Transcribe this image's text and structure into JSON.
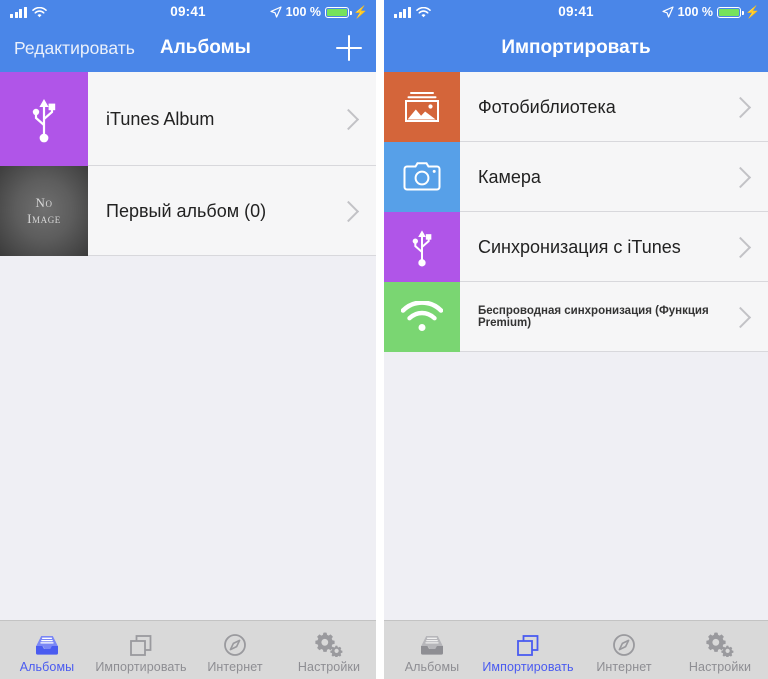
{
  "status_bar": {
    "time": "09:41",
    "battery_percent": "100 %",
    "signal_icon": "cellular-bars-icon",
    "wifi_icon": "wifi-icon",
    "location_icon": "location-arrow-icon",
    "battery_icon": "battery-icon",
    "charging_icon": "lightning-bolt-icon"
  },
  "colors": {
    "nav_blue": "#4a86e8",
    "tile_purple": "#b055e8",
    "tile_orange": "#d4653a",
    "tile_blue": "#57a0e8",
    "tile_green": "#7ad672",
    "tab_active": "#4a5bf0",
    "tab_inactive": "#8e8e93"
  },
  "left_screen": {
    "nav": {
      "edit_label": "Редактировать",
      "title": "Альбомы",
      "add_icon": "plus-icon"
    },
    "albums": [
      {
        "label": "iTunes Album",
        "thumb": "usb-icon",
        "thumb_kind": "usb",
        "chevron": "chevron-right-icon"
      },
      {
        "label": "Первый альбом (0)",
        "thumb": "no-image-placeholder",
        "thumb_kind": "noimage",
        "placeholder_line1": "No",
        "placeholder_line2": "Image",
        "chevron": "chevron-right-icon"
      }
    ]
  },
  "right_screen": {
    "nav": {
      "title": "Импортировать"
    },
    "sources": [
      {
        "label": "Фотобиблиотека",
        "icon": "photo-library-icon",
        "color": "orange",
        "chevron": "chevron-right-icon",
        "small": false
      },
      {
        "label": "Камера",
        "icon": "camera-icon",
        "color": "blue",
        "chevron": "chevron-right-icon",
        "small": false
      },
      {
        "label": "Синхронизация с iTunes",
        "icon": "usb-icon",
        "color": "purple",
        "chevron": "chevron-right-icon",
        "small": false
      },
      {
        "label": "Беспроводная синхронизация (Функция Premium)",
        "icon": "wifi-icon",
        "color": "green",
        "chevron": "chevron-right-icon",
        "small": true
      }
    ]
  },
  "tab_bar": {
    "items": [
      {
        "label": "Альбомы",
        "icon": "albums-tray-icon"
      },
      {
        "label": "Импортировать",
        "icon": "copy-stack-icon"
      },
      {
        "label": "Интернет",
        "icon": "compass-icon"
      },
      {
        "label": "Настройки",
        "icon": "gears-icon"
      }
    ],
    "left_active_index": 0,
    "right_active_index": 1
  }
}
